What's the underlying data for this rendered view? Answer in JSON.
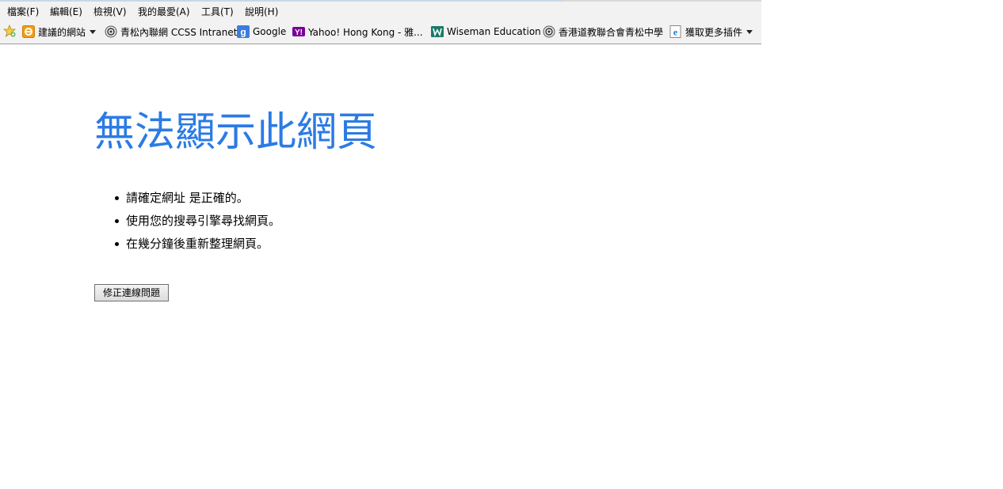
{
  "menubar": {
    "items": [
      {
        "label": "檔案(F)"
      },
      {
        "label": "編輯(E)"
      },
      {
        "label": "檢視(V)"
      },
      {
        "label": "我的最愛(A)"
      },
      {
        "label": "工具(T)"
      },
      {
        "label": "說明(H)"
      }
    ]
  },
  "favorites": {
    "items": [
      {
        "label": "建議的網站",
        "icon": "suggested-sites-icon"
      },
      {
        "label": "青松內聯網 CCSS Intranet",
        "icon": "ccss-icon"
      },
      {
        "label": "Google",
        "icon": "google-icon"
      },
      {
        "label": "Yahoo! Hong Kong - 雅...",
        "icon": "yahoo-icon"
      },
      {
        "label": "Wiseman Education",
        "icon": "wiseman-icon"
      },
      {
        "label": "香港道教聯合會青松中學",
        "icon": "ccss-icon"
      },
      {
        "label": "獲取更多插件",
        "icon": "ie-addon-icon"
      }
    ]
  },
  "error_page": {
    "title": "無法顯示此網頁",
    "suggestions": [
      "請確定網址 是正確的。",
      "使用您的搜尋引擎尋找網頁。",
      "在幾分鐘後重新整理網頁。"
    ],
    "fix_button_label": "修正連線問題"
  },
  "colors": {
    "title": "#2b7be4",
    "chrome_bg": "#f2f2f2"
  }
}
